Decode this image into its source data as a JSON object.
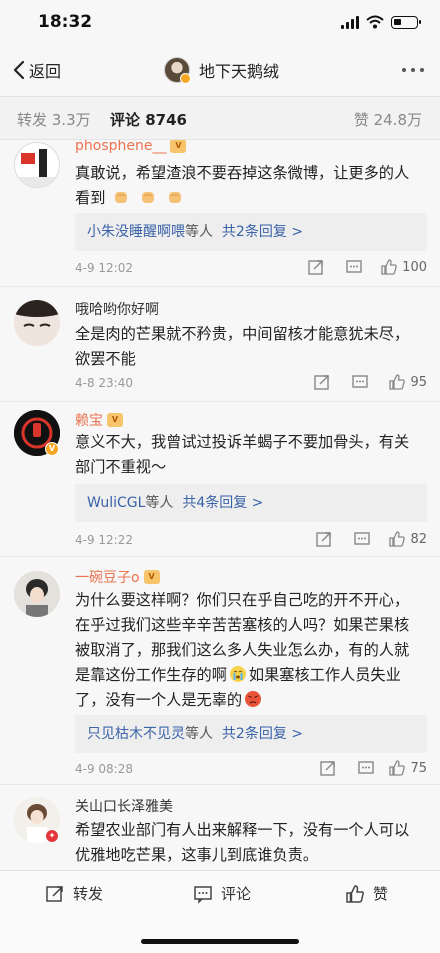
{
  "status_bar": {
    "time": "18:32"
  },
  "nav": {
    "back_label": "返回",
    "title": "地下天鹅绒"
  },
  "tabs": [
    {
      "label": "转发 3.3万"
    },
    {
      "label": "评论 8746"
    },
    {
      "label": "赞 24.8万"
    }
  ],
  "comments": [
    {
      "name": "phosphene__",
      "line1": "真敢说，希望渣浪不要吞掉这条微博，让更多的人",
      "line2": "看到",
      "reply_name": "小朱没睡醒啊喂",
      "reply_mid": "等人",
      "reply_count": "共2条回复 >",
      "time": "4-9 12:02",
      "likes": "100"
    },
    {
      "name": "哦哈哟你好啊",
      "line1": "全是肉的芒果就不矜贵，中间留核才能意犹未尽，",
      "line2": "欲罢不能",
      "time": "4-8 23:40",
      "likes": "95"
    },
    {
      "name": "赖宝",
      "line1": "意义不大，我曾试过投诉羊蝎子不要加骨头，有关",
      "line2": "部门不重视～",
      "reply_name": "WuliCGL",
      "reply_mid": "等人",
      "reply_count": "共4条回复 >",
      "time": "4-9 12:22",
      "likes": "82"
    },
    {
      "name": "一碗豆子o",
      "line1": "为什么要这样啊？你们只在乎自己吃的开不开心，",
      "line2": "在乎过我们这些辛辛苦苦塞核的人吗？如果芒果核",
      "line3": "被取消了，那我们这么多人失业怎么办，有的人就",
      "line4a": "是靠这份工作生存的啊",
      "line4b": "如果塞核工作人员失业",
      "line5": "了，没有一个人是无辜的",
      "reply_name": "只见枯木不见灵",
      "reply_mid": "等人",
      "reply_count": "共2条回复 >",
      "time": "4-9 08:28",
      "likes": "75"
    },
    {
      "name": "关山口长泽雅美",
      "line1": "希望农业部门有人出来解释一下，没有一个人可以",
      "line2": "优雅地吃芒果，这事儿到底谁负责。"
    }
  ],
  "bottom_bar": {
    "repost": "转发",
    "comment": "评论",
    "like": "赞"
  },
  "colors": {
    "orange_name": "#eb7350",
    "link_blue": "#3b63a8",
    "vip_gold": "#f7c36b"
  }
}
